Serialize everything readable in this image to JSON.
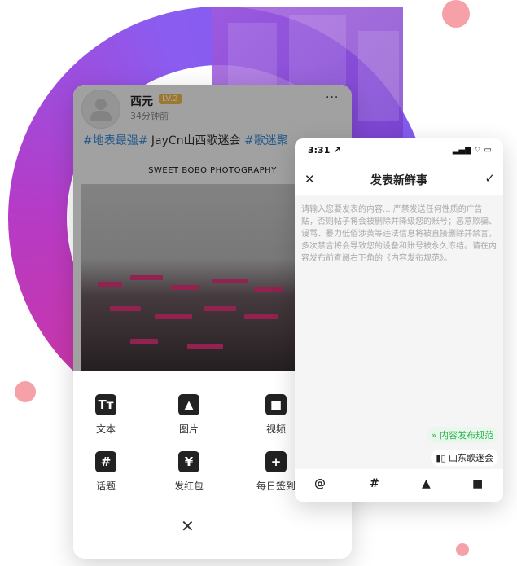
{
  "colors": {
    "ring_start": "#d2349c",
    "ring_end": "#7a5ef2",
    "hashtag": "#3a8bd6",
    "accent_green": "#2bb24c",
    "dot": "#f6a1a8"
  },
  "left_phone": {
    "post": {
      "username": "西元",
      "level": "LV.2",
      "time": "34分钟前",
      "more": "···",
      "text_tag1": "#地表最强#",
      "text_middle": " JayCn山西歌迷会 ",
      "text_tag2": "#歌迷聚",
      "photo_caption": "SWEET BOBO PHOTOGRAPHY"
    },
    "menu": {
      "items": [
        {
          "icon": "text-icon",
          "glyph": "Tт",
          "label": "文本"
        },
        {
          "icon": "image-icon",
          "glyph": "▲",
          "label": "图片"
        },
        {
          "icon": "video-icon",
          "glyph": "■",
          "label": "视频"
        },
        {
          "icon": "hashtag-icon",
          "glyph": "#",
          "label": "话题"
        },
        {
          "icon": "red-envelope-icon",
          "glyph": "¥",
          "label": "发红包"
        },
        {
          "icon": "checkin-icon",
          "glyph": "+",
          "label": "每日签到"
        }
      ],
      "close": "✕"
    }
  },
  "right_phone": {
    "status_time": "3:31 ↗",
    "status_icons": "▂▄▆ ⌔ ▭",
    "title": "发表新鲜事",
    "close": "✕",
    "confirm": "✓",
    "placeholder": "请输入您要发表的内容... 严禁发送任何性质的广告贴，否则帖子将会被删除并降级您的账号；恶意欺骗、谩骂、暴力低俗涉黄等违法信息将被直接删除并禁言，多次禁言将会导致您的设备和账号被永久冻结。请在内容发布前查阅右下角的《内容发布规范》。",
    "rule_chip": "内容发布规范",
    "location_chip": "山东歌迷会",
    "toolbar": {
      "at": "@",
      "hashtag": "#",
      "image": "▲",
      "video": "■"
    }
  }
}
